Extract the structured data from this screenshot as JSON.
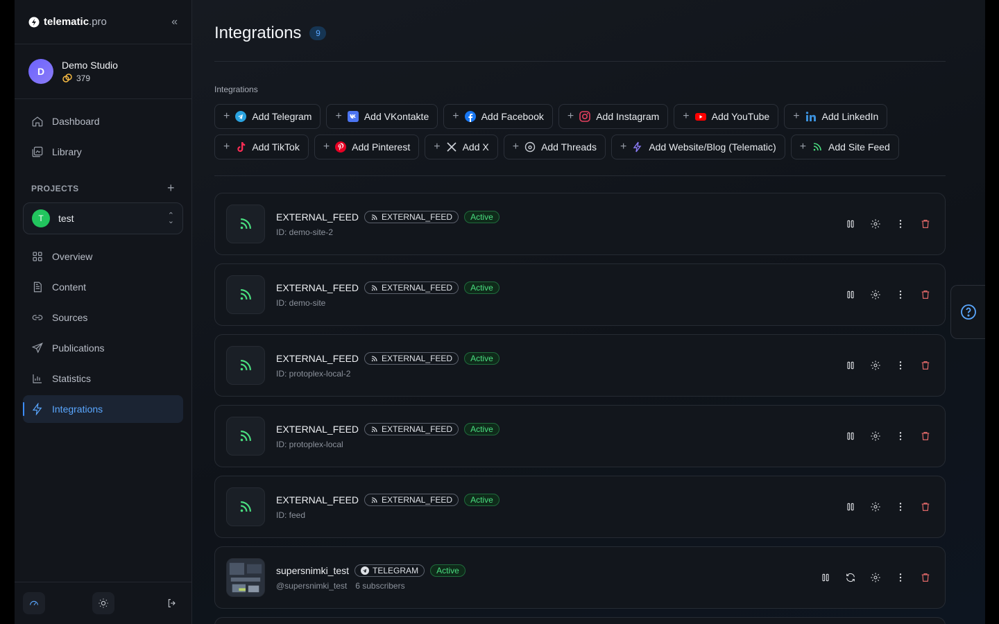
{
  "sidebar": {
    "logo_main": "telematic",
    "logo_suffix": ".pro",
    "studio": {
      "initial": "D",
      "name": "Demo Studio",
      "credits": "379"
    },
    "nav_top": [
      {
        "label": "Dashboard",
        "icon": "home-icon"
      },
      {
        "label": "Library",
        "icon": "library-icon"
      }
    ],
    "projects_label": "PROJECTS",
    "project": {
      "initial": "T",
      "name": "test"
    },
    "nav_project": [
      {
        "label": "Overview",
        "icon": "grid-icon"
      },
      {
        "label": "Content",
        "icon": "file-icon"
      },
      {
        "label": "Sources",
        "icon": "link-icon"
      },
      {
        "label": "Publications",
        "icon": "send-icon"
      },
      {
        "label": "Statistics",
        "icon": "bar-chart-icon"
      },
      {
        "label": "Integrations",
        "icon": "bolt-icon",
        "active": true
      }
    ]
  },
  "main": {
    "title": "Integrations",
    "count": "9",
    "section_label": "Integrations",
    "add_buttons_row1": [
      {
        "label": "Add Telegram",
        "icon": "telegram-icon"
      },
      {
        "label": "Add VKontakte",
        "icon": "vk-icon"
      },
      {
        "label": "Add Facebook",
        "icon": "facebook-icon"
      },
      {
        "label": "Add Instagram",
        "icon": "instagram-icon"
      },
      {
        "label": "Add YouTube",
        "icon": "youtube-icon"
      },
      {
        "label": "Add LinkedIn",
        "icon": "linkedin-icon"
      }
    ],
    "add_buttons_row2": [
      {
        "label": "Add TikTok",
        "icon": "tiktok-icon"
      },
      {
        "label": "Add Pinterest",
        "icon": "pinterest-icon"
      },
      {
        "label": "Add X",
        "icon": "x-icon"
      },
      {
        "label": "Add Threads",
        "icon": "threads-icon"
      },
      {
        "label": "Add Website/Blog (Telematic)",
        "icon": "bolt-icon"
      },
      {
        "label": "Add Site Feed",
        "icon": "rss-icon"
      }
    ],
    "integrations": [
      {
        "name": "EXTERNAL_FEED",
        "type": "EXTERNAL_FEED",
        "status": "Active",
        "sub": "ID: demo-site-2",
        "sub2": ""
      },
      {
        "name": "EXTERNAL_FEED",
        "type": "EXTERNAL_FEED",
        "status": "Active",
        "sub": "ID: demo-site",
        "sub2": ""
      },
      {
        "name": "EXTERNAL_FEED",
        "type": "EXTERNAL_FEED",
        "status": "Active",
        "sub": "ID: protoplex-local-2",
        "sub2": ""
      },
      {
        "name": "EXTERNAL_FEED",
        "type": "EXTERNAL_FEED",
        "status": "Active",
        "sub": "ID: protoplex-local",
        "sub2": ""
      },
      {
        "name": "EXTERNAL_FEED",
        "type": "EXTERNAL_FEED",
        "status": "Active",
        "sub": "ID: feed",
        "sub2": ""
      },
      {
        "name": "supersnimki_test",
        "type": "TELEGRAM",
        "status": "Active",
        "sub": "@supersnimki_test",
        "sub2": "6 subscribers"
      }
    ]
  },
  "colors": {
    "accent": "#5aa7ff",
    "active_green": "#4ade80",
    "danger": "#f87171",
    "rss_green": "#4ade80"
  }
}
